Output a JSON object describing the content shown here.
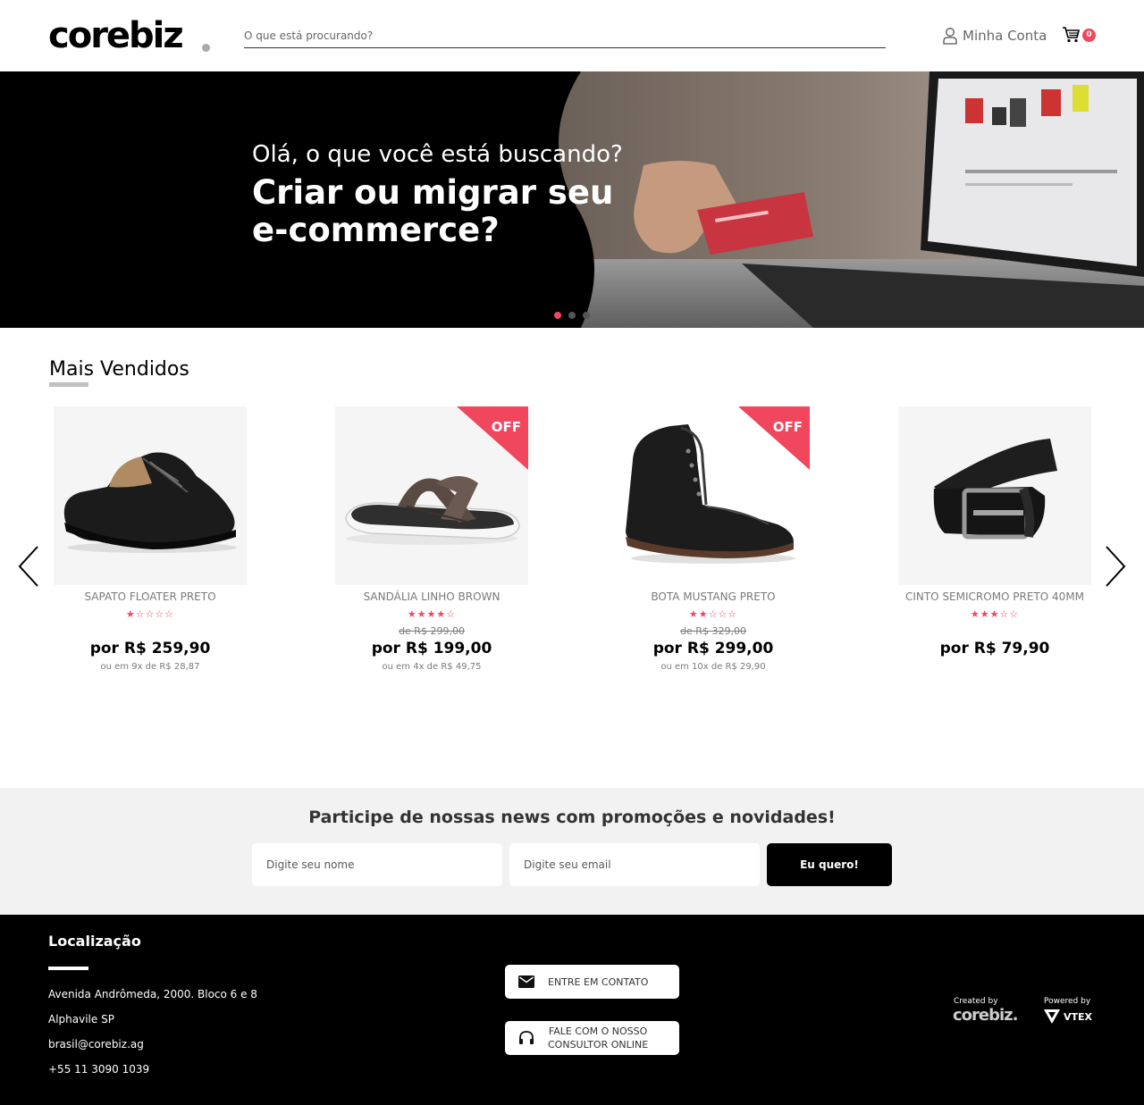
{
  "header": {
    "logo": "corebiz",
    "search_placeholder": "O que está procurando?",
    "account_label": "Minha Conta",
    "cart_count": "0"
  },
  "banner": {
    "subtitle": "Olá, o que você está buscando?",
    "title": "Criar ou migrar seu e-commerce?",
    "slides": 3,
    "active_slide": 1
  },
  "bestsellers": {
    "title": "Mais Vendidos",
    "products": [
      {
        "name": "SAPATO FLOATER PRETO",
        "stars": "★☆☆☆☆",
        "rating": 1,
        "old_price": "",
        "price": "por R$ 259,90",
        "installments": "ou em 9x de R$ 28,87",
        "off": false
      },
      {
        "name": "SANDÁLIA LINHO BROWN",
        "stars": "★★★★☆",
        "rating": 4,
        "old_price": "de R$ 299,00",
        "price": "por R$ 199,00",
        "installments": "ou em 4x de R$ 49,75",
        "off": true
      },
      {
        "name": "BOTA MUSTANG PRETO",
        "stars": "★★☆☆☆",
        "rating": 2,
        "old_price": "de R$ 329,00",
        "price": "por R$ 299,00",
        "installments": "ou em 10x de R$ 29,90",
        "off": true
      },
      {
        "name": "CINTO SEMICROMO PRETO 40MM",
        "stars": "★★★☆☆",
        "rating": 3,
        "old_price": "",
        "price": "por R$ 79,90",
        "installments": "",
        "off": false
      }
    ],
    "off_label": "OFF"
  },
  "newsletter": {
    "title": "Participe de nossas news com promoções e novidades!",
    "name_placeholder": "Digite seu nome",
    "email_placeholder": "Digite seu email",
    "button_label": "Eu quero!"
  },
  "footer": {
    "title": "Localização",
    "address": "Avenida Andrômeda, 2000. Bloco 6 e 8",
    "city": "Alphavile SP",
    "email": "brasil@corebiz.ag",
    "phone": "+55 11 3090 1039",
    "contact_button": "ENTRE EM CONTATO",
    "consultant_button_line1": "FALE COM O NOSSO",
    "consultant_button_line2": "CONSULTOR ONLINE",
    "created_by": "Created by",
    "created_by_logo": "corebiz.",
    "powered_by": "Powered by",
    "powered_by_logo": "VTEX"
  },
  "colors": {
    "accent": "#f0465e",
    "footer_bg": "#000000",
    "newsletter_bg": "#f2f2f2"
  }
}
